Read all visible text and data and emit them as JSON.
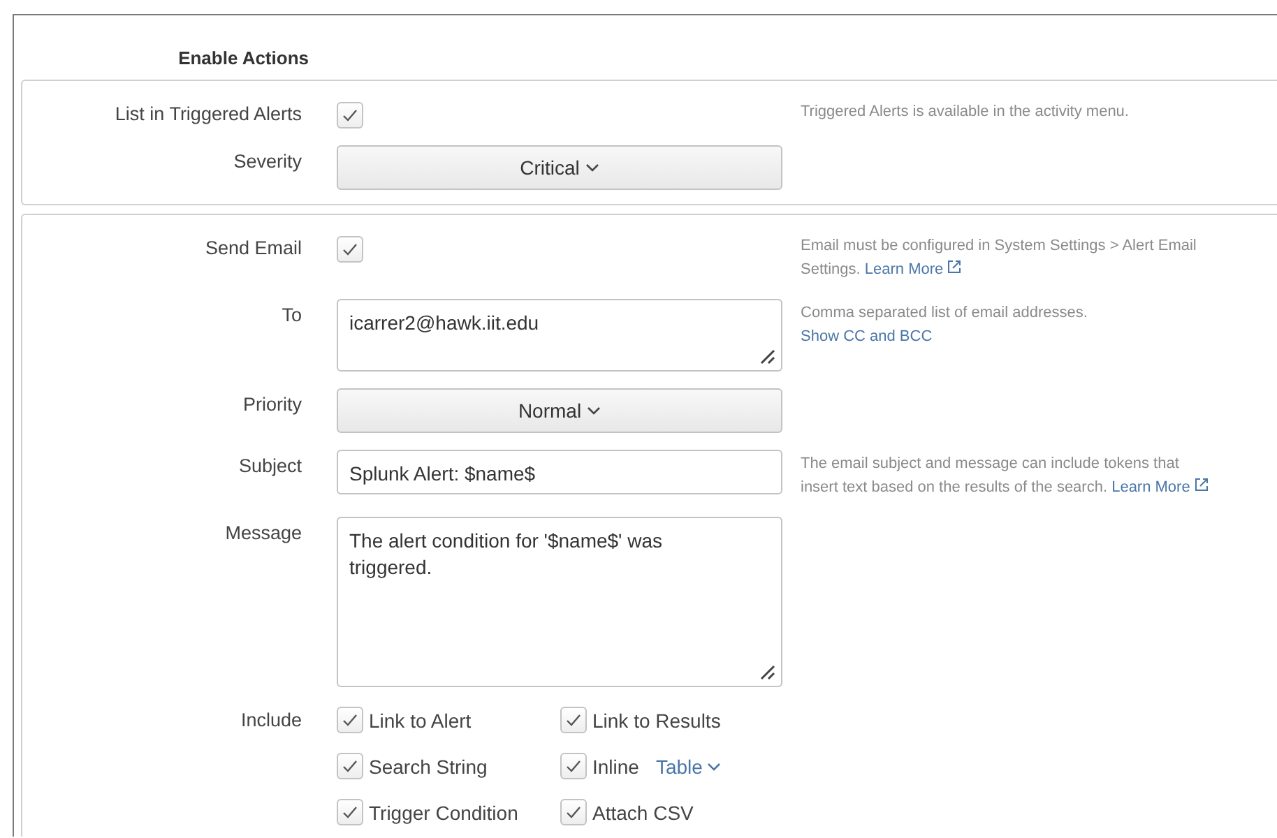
{
  "heading": "Enable Actions",
  "sections": [
    {
      "rows": [
        {
          "kind": "checkbox",
          "label": "List in Triggered Alerts",
          "checked": true,
          "help": {
            "text": "Triggered Alerts is available in the activity menu."
          }
        },
        {
          "kind": "dropdown",
          "label": "Severity",
          "value": "Critical"
        }
      ]
    },
    {
      "rows": [
        {
          "kind": "checkbox",
          "label": "Send Email",
          "checked": true,
          "help": {
            "text": "Email must be configured in System Settings > Alert Email Settings.",
            "link": "Learn More",
            "link_new_line": false
          }
        },
        {
          "kind": "textarea",
          "label": "To",
          "value": "icarrer2@hawk.iit.edu",
          "help": {
            "text": "Comma separated list of email addresses.",
            "link": "Show CC and BCC",
            "link_new_line": true
          }
        },
        {
          "kind": "dropdown",
          "label": "Priority",
          "value": "Normal"
        },
        {
          "kind": "input",
          "label": "Subject",
          "value": "Splunk Alert: $name$",
          "help": {
            "text": "The email subject and message can include tokens that insert text based on the results of the search.",
            "link": "Learn More",
            "link_new_line": false
          }
        },
        {
          "kind": "bigtextarea",
          "label": "Message",
          "value": "The alert condition for '$name$' was triggered."
        },
        {
          "kind": "checkgroup",
          "label": "Include",
          "options": [
            {
              "label": "Link to Alert",
              "checked": true
            },
            {
              "label": "Link to Results",
              "checked": true
            },
            {
              "label": "Search String",
              "checked": true
            },
            {
              "label": "Inline",
              "checked": true,
              "dropdown": "Table"
            },
            {
              "label": "Trigger Condition",
              "checked": true
            },
            {
              "label": "Attach CSV",
              "checked": true
            }
          ]
        }
      ]
    }
  ]
}
